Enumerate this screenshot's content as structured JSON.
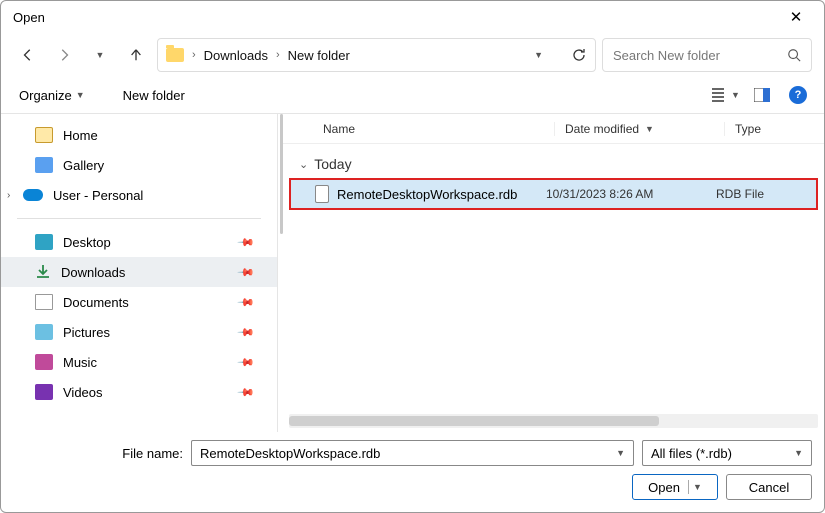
{
  "window": {
    "title": "Open"
  },
  "breadcrumb": {
    "items": [
      "Downloads",
      "New folder"
    ]
  },
  "search": {
    "placeholder": "Search New folder"
  },
  "toolbar": {
    "organize": "Organize",
    "newfolder": "New folder"
  },
  "sidebar": {
    "home": "Home",
    "gallery": "Gallery",
    "user": "User - Personal",
    "desktop": "Desktop",
    "downloads": "Downloads",
    "documents": "Documents",
    "pictures": "Pictures",
    "music": "Music",
    "videos": "Videos"
  },
  "columns": {
    "name": "Name",
    "date": "Date modified",
    "type": "Type"
  },
  "group": "Today",
  "file": {
    "name": "RemoteDesktopWorkspace.rdb",
    "date": "10/31/2023 8:26 AM",
    "type": "RDB File"
  },
  "footer": {
    "filename_label": "File name:",
    "filename_value": "RemoteDesktopWorkspace.rdb",
    "filter": "All files (*.rdb)",
    "open": "Open",
    "cancel": "Cancel"
  }
}
